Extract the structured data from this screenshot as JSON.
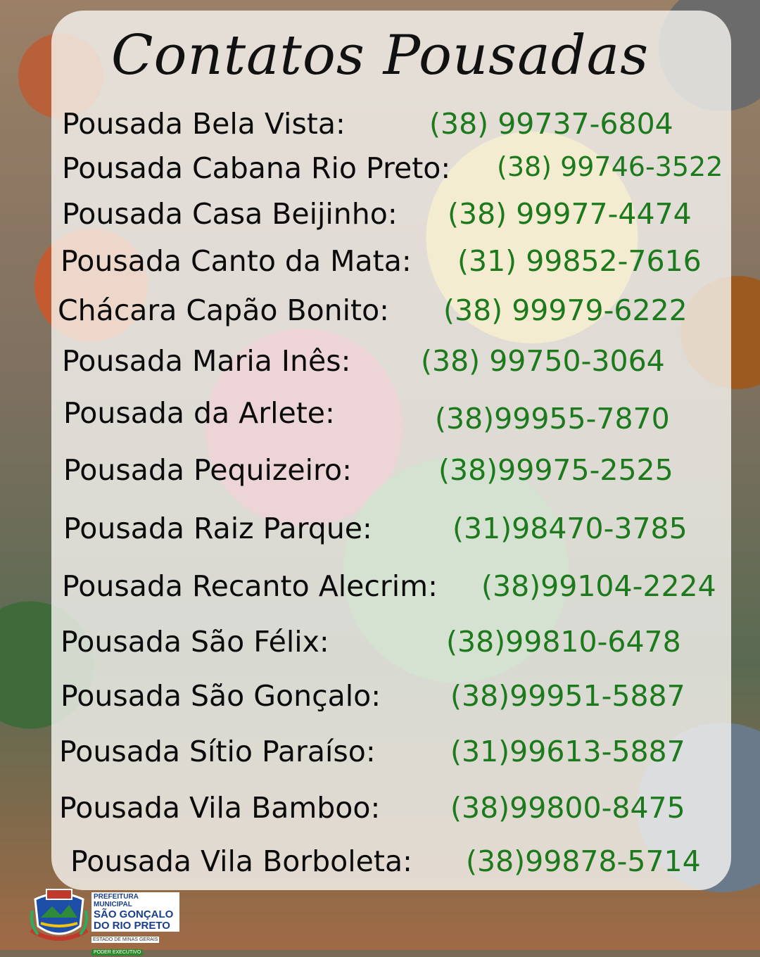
{
  "title": "Contatos Pousadas",
  "contacts": [
    {
      "name": "Pousada Bela Vista:",
      "phone": "(38) 99737-6804"
    },
    {
      "name": "Pousada Cabana Rio Preto:",
      "phone": "(38) 99746-3522"
    },
    {
      "name": "Pousada Casa Beijinho:",
      "phone": "(38) 99977-4474"
    },
    {
      "name": "Pousada Canto da Mata:",
      "phone": "(31) 99852-7616"
    },
    {
      "name": "Chácara Capão Bonito:",
      "phone": "(38) 99979-6222"
    },
    {
      "name": "Pousada Maria Inês:",
      "phone": "(38) 99750-3064"
    },
    {
      "name": "Pousada da Arlete:",
      "phone": "(38)99955-7870"
    },
    {
      "name": "Pousada Pequizeiro:",
      "phone": "(38)99975-2525"
    },
    {
      "name": "Pousada Raiz Parque:",
      "phone": "(31)98470-3785"
    },
    {
      "name": "Pousada Recanto Alecrim:",
      "phone": "(38)99104-2224"
    },
    {
      "name": "Pousada São Félix:",
      "phone": "(38)99810-6478"
    },
    {
      "name": "Pousada São Gonçalo:",
      "phone": "(38)99951-5887"
    },
    {
      "name": "Pousada Sítio Paraíso:",
      "phone": "(31)99613-5887"
    },
    {
      "name": "Pousada Vila Bamboo:",
      "phone": "(38)99800-8475"
    },
    {
      "name": "Pousada Vila Borboleta:",
      "phone": "(38)99878-5714"
    }
  ],
  "logo": {
    "line1": "PREFEITURA MUNICIPAL",
    "line2": "SÃO GONÇALO",
    "line3": "DO RIO PRETO",
    "line4": "ESTADO DE MINAS GERAIS",
    "line5": "PODER EXECUTIVO"
  },
  "colors": {
    "name": "#0b0b0b",
    "phone": "#1c7a1c",
    "card": "#f8f6f2"
  }
}
